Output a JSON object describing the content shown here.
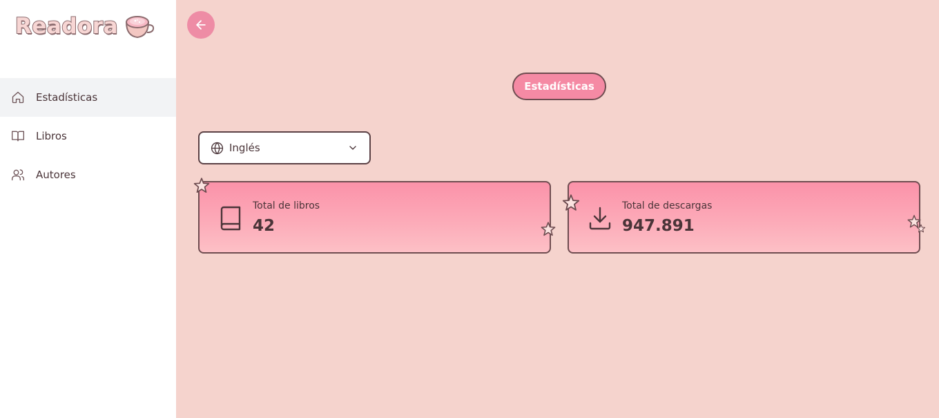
{
  "app": {
    "name": "Readora"
  },
  "sidebar": {
    "items": [
      {
        "label": "Estadísticas",
        "icon": "home-icon",
        "active": true
      },
      {
        "label": "Libros",
        "icon": "book-open-icon",
        "active": false
      },
      {
        "label": "Autores",
        "icon": "users-icon",
        "active": false
      }
    ]
  },
  "header": {
    "back_icon": "arrow-left-icon"
  },
  "main": {
    "title": "Estadísticas",
    "language_select": {
      "value": "Inglés",
      "icon": "globe-icon"
    },
    "stats": [
      {
        "label": "Total de libros",
        "value": "42",
        "icon": "book-icon"
      },
      {
        "label": "Total de descargas",
        "value": "947.891",
        "icon": "download-icon"
      }
    ]
  },
  "colors": {
    "accent": "#f58aa4",
    "background": "#f5d3cd",
    "text": "#4a3438",
    "card_gradient_top": "#fb92a9",
    "card_gradient_bottom": "#fdc0c6"
  }
}
